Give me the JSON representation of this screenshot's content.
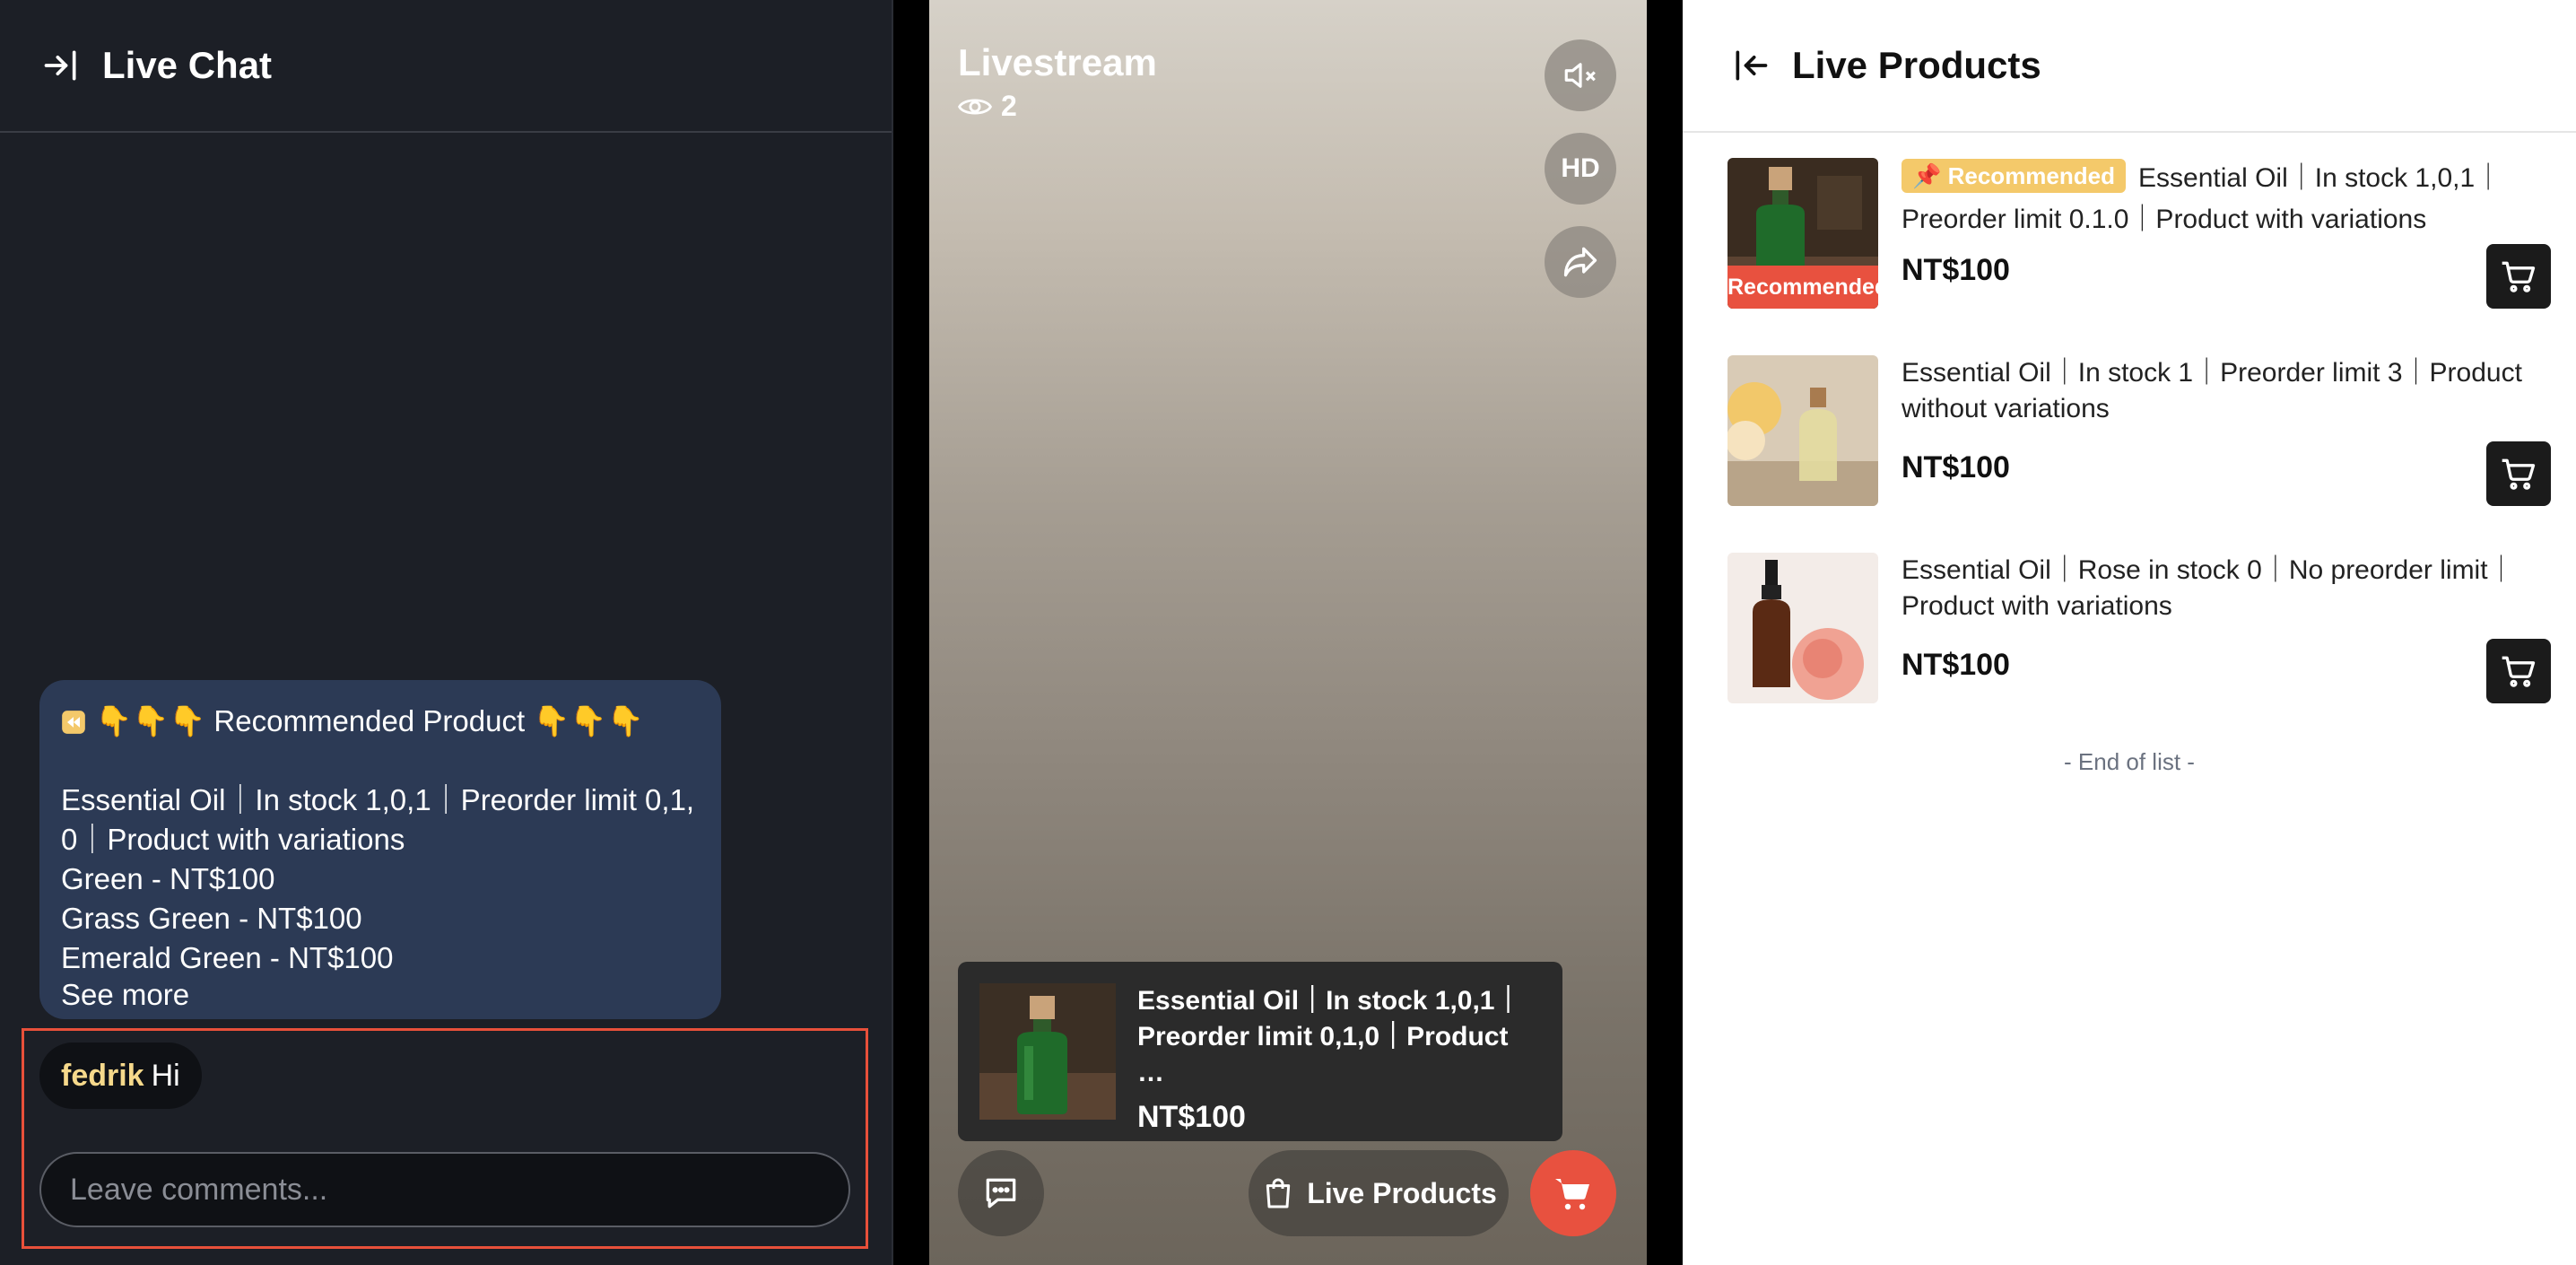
{
  "chat": {
    "title": "Live Chat",
    "message": {
      "heading": "👇👇👇 Recommended Product 👇👇👇",
      "line1": "Essential Oil｜In stock 1,0,1｜Preorder limit 0,1,",
      "line2": "0｜Product with variations",
      "variants": [
        "Green - NT$100",
        "Grass Green - NT$100",
        "Emerald Green - NT$100"
      ],
      "see_more": "See more"
    },
    "user_message": {
      "name": "fedrik",
      "text": "Hi"
    },
    "input_placeholder": "Leave comments..."
  },
  "stream": {
    "title": "Livestream",
    "viewers": "2",
    "hd_label": "HD",
    "popup": {
      "desc": "Essential Oil｜In stock 1,0,1｜Preorder limit 0,1,0｜Product …",
      "price": "NT$100"
    },
    "live_products_label": "Live Products",
    "colors": {
      "cart": "#e8513f"
    }
  },
  "products": {
    "title": "Live Products",
    "items": [
      {
        "badge": "Recommended",
        "desc": "Essential Oil｜In stock 1,0,1｜Preorder limit 0.1.0｜Product with variations",
        "thumb_label": "Recommended Product",
        "price": "NT$100"
      },
      {
        "desc": "Essential Oil｜In stock 1｜Preorder limit 3｜Product without variations",
        "price": "NT$100"
      },
      {
        "desc": "Essential Oil｜Rose in stock 0｜No preorder limit｜Product with variations",
        "price": "NT$100"
      }
    ],
    "end_of_list": "- End of list -"
  }
}
